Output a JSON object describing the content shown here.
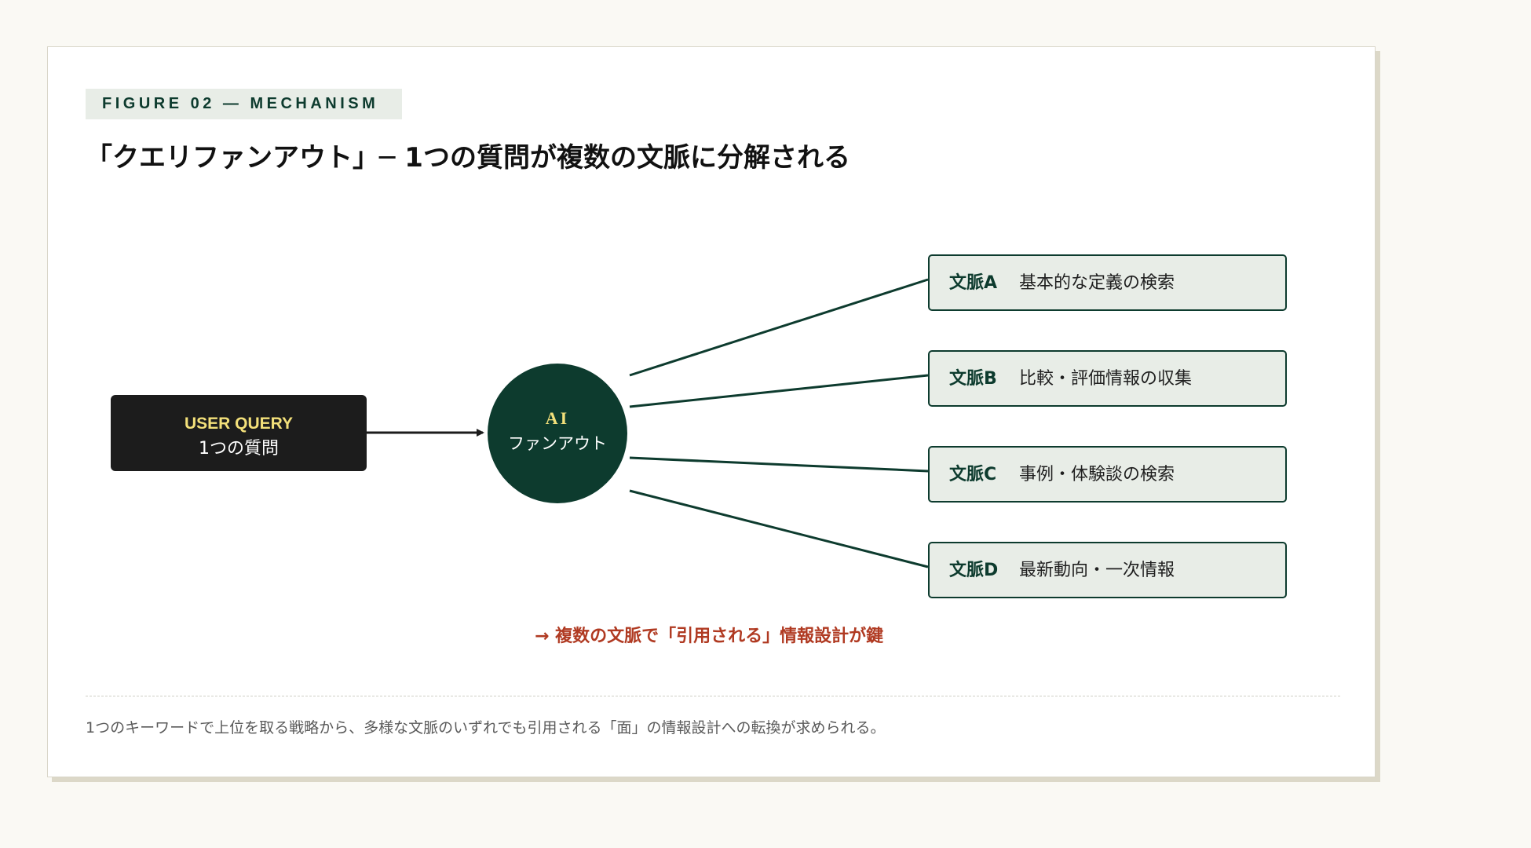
{
  "figure": {
    "tag": "FIGURE 02 — MECHANISM",
    "title": "「クエリファンアウト」─ 1つの質問が複数の文脈に分解される"
  },
  "diagram": {
    "query": {
      "label": "USER QUERY",
      "text": "1つの質問"
    },
    "hub": {
      "label": "AI",
      "text": "ファンアウト"
    },
    "contexts": [
      {
        "name": "文脈A",
        "desc": "基本的な定義の検索"
      },
      {
        "name": "文脈B",
        "desc": "比較・評価情報の収集"
      },
      {
        "name": "文脈C",
        "desc": "事例・体験談の検索"
      },
      {
        "name": "文脈D",
        "desc": "最新動向・一次情報"
      }
    ],
    "callout": "→ 複数の文脈で「引用される」情報設計が鍵"
  },
  "caption": "1つのキーワードで上位を取る戦略から、多様な文脈のいずれでも引用される「面」の情報設計への転換が求められる。",
  "colors": {
    "accent_green": "#0d3b2e",
    "context_fill": "#e8ede7",
    "highlight_yellow": "#f3e07a",
    "callout_red": "#b03a22",
    "query_fill": "#1c1c1c"
  }
}
